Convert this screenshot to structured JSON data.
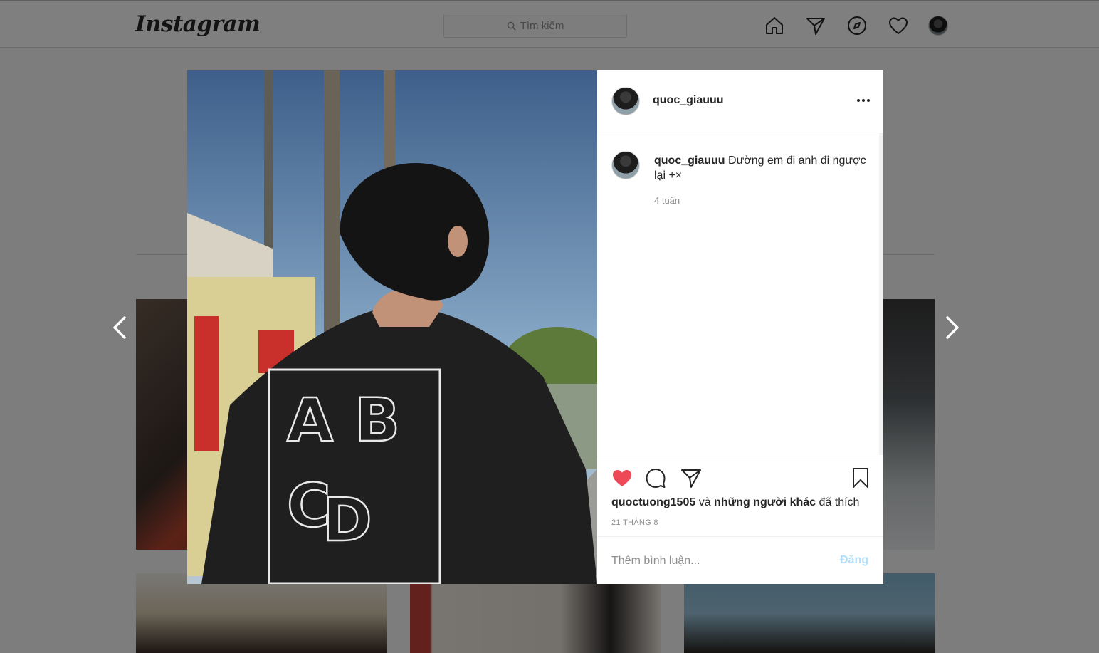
{
  "topbar": {
    "logo": "Instagram",
    "search_placeholder": "Tìm kiếm",
    "icons": [
      "home-icon",
      "direct-icon",
      "explore-icon",
      "activity-heart-icon",
      "profile-avatar"
    ]
  },
  "post": {
    "username": "quoc_giauuu",
    "caption_user": "quoc_giauuu",
    "caption_text": "Đường em đi anh đi ngược lại +×",
    "caption_time": "4 tuần",
    "liked_by_user": "quoctuong1505",
    "liked_by_and": "và",
    "liked_by_others": "những người khác",
    "liked_by_suffix": "đã thích",
    "date": "21 THÁNG 8",
    "comment_placeholder": "Thêm bình luận...",
    "post_button": "Đăng",
    "liked": true
  },
  "colors": {
    "like_red": "#ed4956",
    "post_button_disabled": "#b2dffc",
    "overlay": "rgba(0,0,0,0.5)"
  }
}
